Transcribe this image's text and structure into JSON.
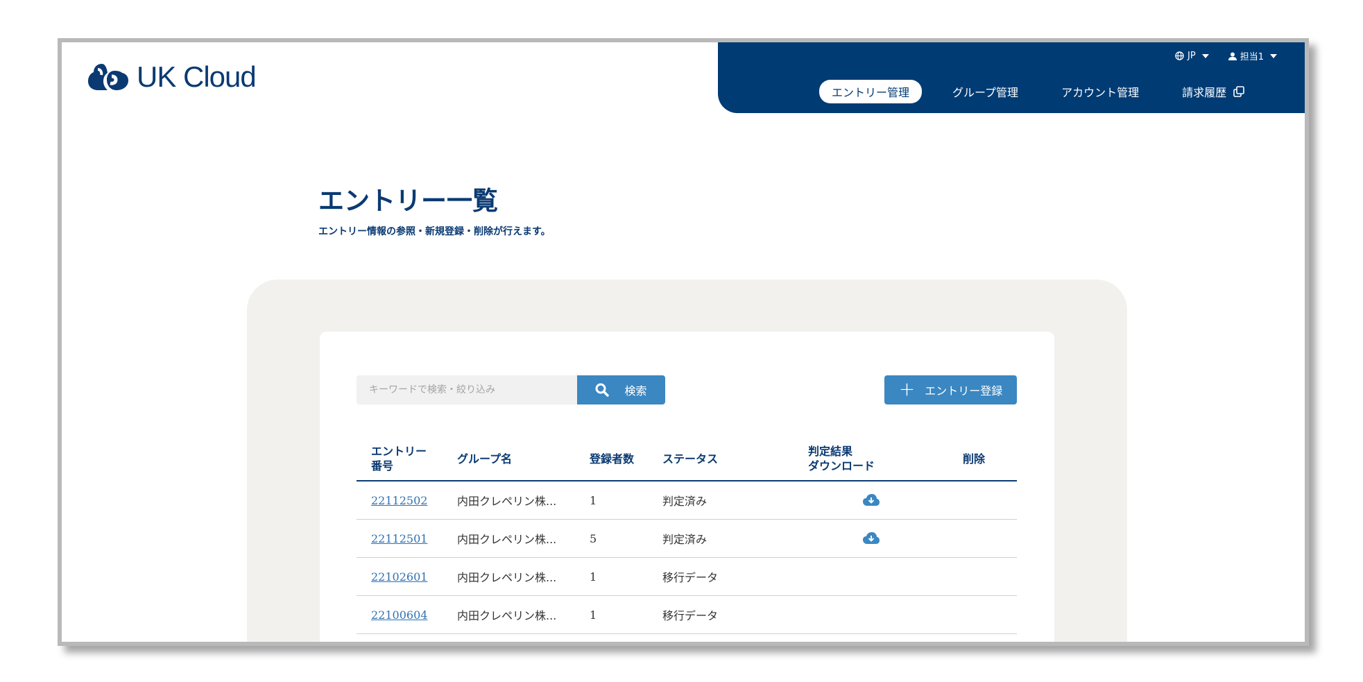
{
  "brand": {
    "name": "UK Cloud"
  },
  "header": {
    "language": "JP",
    "user": "担当1",
    "nav": [
      {
        "label": "エントリー管理",
        "active": true
      },
      {
        "label": "グループ管理",
        "active": false
      },
      {
        "label": "アカウント管理",
        "active": false
      },
      {
        "label": "請求履歴",
        "active": false
      }
    ]
  },
  "page": {
    "title": "エントリー一覧",
    "description": "エントリー情報の参照・新規登録・削除が行えます。"
  },
  "search": {
    "placeholder": "キーワードで検索・絞り込み",
    "value": "",
    "button_label": "検索"
  },
  "add_button_label": "エントリー登録",
  "table": {
    "headers": {
      "entry_no_line1": "エントリー",
      "entry_no_line2": "番号",
      "group": "グループ名",
      "count": "登録者数",
      "status": "ステータス",
      "download_line1": "判定結果",
      "download_line2": "ダウンロード",
      "delete": "削除"
    },
    "rows": [
      {
        "entry_no": "22112502",
        "group": "内田クレペリン株...",
        "count": "1",
        "status": "判定済み",
        "download": true
      },
      {
        "entry_no": "22112501",
        "group": "内田クレペリン株...",
        "count": "5",
        "status": "判定済み",
        "download": true
      },
      {
        "entry_no": "22102601",
        "group": "内田クレペリン株...",
        "count": "1",
        "status": "移行データ",
        "download": false
      },
      {
        "entry_no": "22100604",
        "group": "内田クレペリン株...",
        "count": "1",
        "status": "移行データ",
        "download": false
      }
    ]
  },
  "colors": {
    "navy": "#003b74",
    "accent_blue": "#3a87c2",
    "link": "#2f72b3",
    "card_bg": "#f2f1ee"
  }
}
